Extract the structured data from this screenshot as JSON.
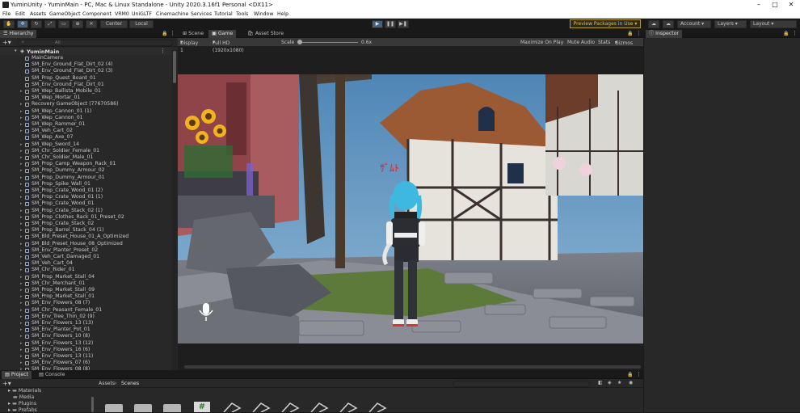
{
  "window": {
    "title": "YuminUnity - YuminMain - PC, Mac & Linux Standalone - Unity 2020.3.16f1 Personal <DX11>"
  },
  "menu": [
    "File",
    "Edit",
    "Assets",
    "GameObject",
    "Component",
    "VRM0",
    "UniGLTF",
    "Cinemachine",
    "Services",
    "Tutorial",
    "Tools",
    "Window",
    "Help"
  ],
  "toolbar": {
    "pivot": "Center",
    "space": "Local",
    "preview_packages": "Preview Packages in Use",
    "account": "Account",
    "layers": "Layers",
    "layout": "Layout"
  },
  "hierarchy": {
    "tab": "Hierarchy",
    "search_placeholder": "All",
    "scene": "YuminMain",
    "items": [
      "MainCamera",
      "SM_Env_Ground_Flat_Dirt_02 (4)",
      "SM_Env_Ground_Flat_Dirt_02 (3)",
      "SM_Prop_Quest_Board_01",
      "SM_Env_Ground_Flat_Dirt_01",
      "SM_Wep_Ballista_Mobile_01",
      "SM_Wep_Mortar_01",
      "Recovery GameObject (77670586)",
      "SM_Wep_Cannon_01 (1)",
      "SM_Wep_Cannon_01",
      "SM_Wep_Rammer_01",
      "SM_Veh_Cart_02",
      "SM_Wep_Axe_07",
      "SM_Wep_Sword_14",
      "SM_Chr_Soldier_Female_01",
      "SM_Chr_Soldier_Male_01",
      "SM_Prop_Camp_Weapon_Rack_01",
      "SM_Prop_Dummy_Armour_02",
      "SM_Prop_Dummy_Armour_01",
      "SM_Prop_Spike_Wall_01",
      "SM_Prop_Crate_Wood_01 (2)",
      "SM_Prop_Crate_Wood_01 (1)",
      "SM_Prop_Crate_Wood_01",
      "SM_Prop_Crate_Stack_02 (1)",
      "SM_Prop_Clothes_Rack_01_Preset_02",
      "SM_Prop_Crate_Stack_02",
      "SM_Prop_Barrel_Stack_04 (1)",
      "SM_Bld_Preset_House_01_A_Optimized",
      "SM_Bld_Preset_House_08_Optimized",
      "SM_Env_Planter_Preset_02",
      "SM_Veh_Cart_Damaged_01",
      "SM_Veh_Cart_04",
      "SM_Chr_Rider_01",
      "SM_Prop_Market_Stall_04",
      "SM_Chr_Merchant_01",
      "SM_Prop_Market_Stall_09",
      "SM_Prop_Market_Stall_01",
      "SM_Env_Flowers_08 (7)",
      "SM_Chr_Peasant_Female_01",
      "SM_Env_Tree_Thin_02 (9)",
      "SM_Env_Flowers_13 (13)",
      "SM_Env_Planter_Pot_01",
      "SM_Env_Flowers_10 (8)",
      "SM_Env_Flowers_13 (12)",
      "SM_Env_Flowers_16 (6)",
      "SM_Env_Flowers_13 (11)",
      "SM_Env_Flowers_07 (6)",
      "SM_Env_Flowers_08 (8)"
    ]
  },
  "game": {
    "tabs": [
      "Scene",
      "Game",
      "Asset Store"
    ],
    "display": "Display 1",
    "resolution": "Full HD (1920x1080)",
    "scale_label": "Scale",
    "scale_value": "0.6x",
    "maximize": "Maximize On Play",
    "mute": "Mute Audio",
    "stats": "Stats",
    "gizmos": "Gizmos"
  },
  "inspector": {
    "tab": "Inspector"
  },
  "project": {
    "tabs": [
      "Project",
      "Console"
    ],
    "folders": [
      "Materials",
      "Media",
      "Plugins",
      "Prefabs"
    ],
    "breadcrumb_root": "Assets",
    "breadcrumb_leaf": "Scenes"
  },
  "colors": {
    "play_active": "#46607c",
    "accent_yellow": "#e6c229"
  }
}
